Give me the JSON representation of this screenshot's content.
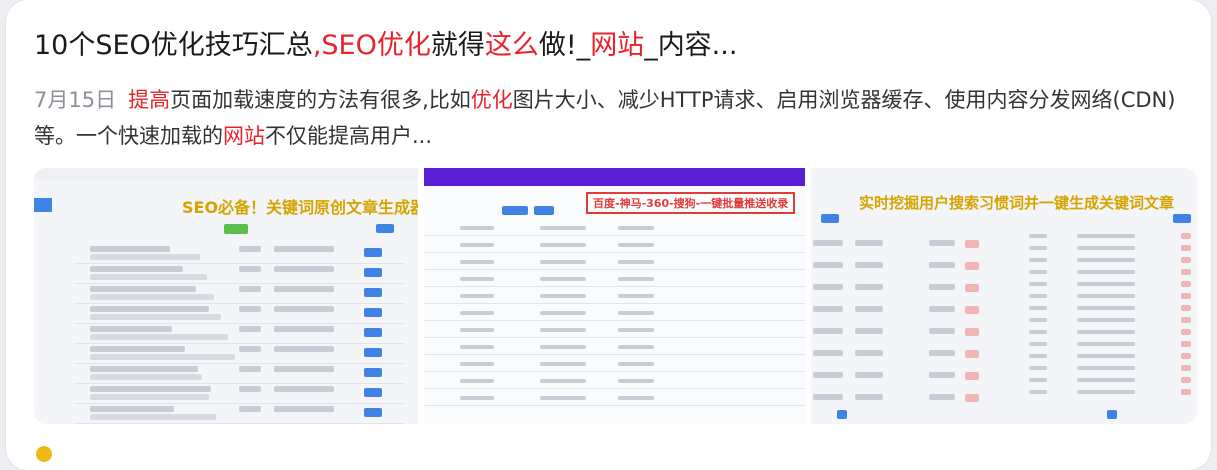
{
  "result": {
    "title_parts": [
      {
        "text": "10个SEO优化技巧汇总",
        "hl": false
      },
      {
        "text": ",SEO优化",
        "hl": true
      },
      {
        "text": "就得",
        "hl": false
      },
      {
        "text": "这么",
        "hl": true
      },
      {
        "text": "做!_",
        "hl": false
      },
      {
        "text": "网站",
        "hl": true
      },
      {
        "text": "_内容...",
        "hl": false
      }
    ],
    "date": "7月15日",
    "snippet_parts": [
      {
        "text": "提高",
        "hl": true
      },
      {
        "text": "页面加载速度的方法有很多,比如",
        "hl": false
      },
      {
        "text": "优化",
        "hl": true
      },
      {
        "text": "图片大小、减少HTTP请求、启用浏览器缓存、使用内容分发网络(CDN)等。一个快速加载的",
        "hl": false
      },
      {
        "text": "网站",
        "hl": true
      },
      {
        "text": "不仅能提高用户...",
        "hl": false
      }
    ],
    "thumbnails": [
      {
        "banner": "SEO必备！关键词原创文章生成器"
      },
      {
        "banner": "百度-神马-360-搜狗-一键批量推送收录"
      },
      {
        "banner": "实时挖掘用户搜索习惯词并一键生成关键词文章"
      }
    ]
  },
  "colors": {
    "highlight": "#e8232a",
    "date": "#8a8f99",
    "accent_purple": "#5b20d6"
  }
}
